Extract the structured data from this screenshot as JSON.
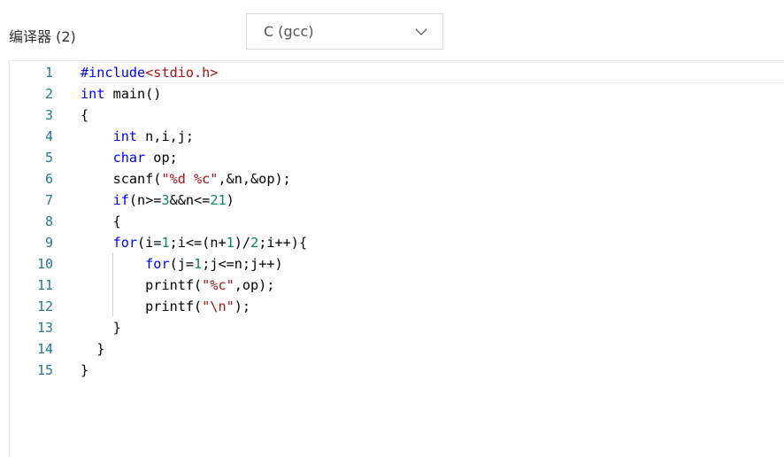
{
  "header": {
    "label": "编译器 (2)"
  },
  "language_select": {
    "value": "C (gcc)",
    "icon": "chevron-down-icon"
  },
  "colors": {
    "keyword": "#0000ff",
    "string": "#a31515",
    "number": "#098658",
    "line_number": "#237893"
  },
  "editor": {
    "current_line": 1,
    "lines": [
      {
        "num": "1",
        "tokens": [
          {
            "t": "#include",
            "c": "keyword"
          },
          {
            "t": "<stdio.h>",
            "c": "string"
          }
        ]
      },
      {
        "num": "2",
        "tokens": [
          {
            "t": "int",
            "c": "keyword"
          },
          {
            "t": " main()",
            "c": "plain"
          }
        ]
      },
      {
        "num": "3",
        "tokens": [
          {
            "t": "{",
            "c": "plain"
          }
        ]
      },
      {
        "num": "4",
        "tokens": [
          {
            "t": "    ",
            "c": "plain"
          },
          {
            "t": "int",
            "c": "keyword"
          },
          {
            "t": " n,i,j;",
            "c": "plain"
          }
        ]
      },
      {
        "num": "5",
        "tokens": [
          {
            "t": "    ",
            "c": "plain"
          },
          {
            "t": "char",
            "c": "keyword"
          },
          {
            "t": " op;",
            "c": "plain"
          }
        ]
      },
      {
        "num": "6",
        "tokens": [
          {
            "t": "    scanf(",
            "c": "plain"
          },
          {
            "t": "\"%d %c\"",
            "c": "string"
          },
          {
            "t": ",&n,&op);",
            "c": "plain"
          }
        ]
      },
      {
        "num": "7",
        "tokens": [
          {
            "t": "    ",
            "c": "plain"
          },
          {
            "t": "if",
            "c": "keyword"
          },
          {
            "t": "(n>=",
            "c": "plain"
          },
          {
            "t": "3",
            "c": "number"
          },
          {
            "t": "&&n<=",
            "c": "plain"
          },
          {
            "t": "21",
            "c": "number"
          },
          {
            "t": ")",
            "c": "plain"
          }
        ]
      },
      {
        "num": "8",
        "tokens": [
          {
            "t": "    {",
            "c": "plain"
          }
        ]
      },
      {
        "num": "9",
        "tokens": [
          {
            "t": "    ",
            "c": "plain"
          },
          {
            "t": "for",
            "c": "keyword"
          },
          {
            "t": "(i=",
            "c": "plain"
          },
          {
            "t": "1",
            "c": "number"
          },
          {
            "t": ";i<=(n+",
            "c": "plain"
          },
          {
            "t": "1",
            "c": "number"
          },
          {
            "t": ")/",
            "c": "plain"
          },
          {
            "t": "2",
            "c": "number"
          },
          {
            "t": ";i++){",
            "c": "plain"
          }
        ]
      },
      {
        "num": "10",
        "tokens": [
          {
            "t": "        ",
            "c": "plain"
          },
          {
            "t": "for",
            "c": "keyword"
          },
          {
            "t": "(j=",
            "c": "plain"
          },
          {
            "t": "1",
            "c": "number"
          },
          {
            "t": ";j<=n;j++)",
            "c": "plain"
          }
        ]
      },
      {
        "num": "11",
        "tokens": [
          {
            "t": "        printf(",
            "c": "plain"
          },
          {
            "t": "\"%c\"",
            "c": "string"
          },
          {
            "t": ",op);",
            "c": "plain"
          }
        ]
      },
      {
        "num": "12",
        "tokens": [
          {
            "t": "        printf(",
            "c": "plain"
          },
          {
            "t": "\"\\n\"",
            "c": "string"
          },
          {
            "t": ");",
            "c": "plain"
          }
        ]
      },
      {
        "num": "13",
        "tokens": [
          {
            "t": "    }",
            "c": "plain"
          }
        ]
      },
      {
        "num": "14",
        "tokens": [
          {
            "t": "  }",
            "c": "plain"
          }
        ]
      },
      {
        "num": "15",
        "tokens": [
          {
            "t": "}",
            "c": "plain"
          }
        ]
      }
    ]
  }
}
